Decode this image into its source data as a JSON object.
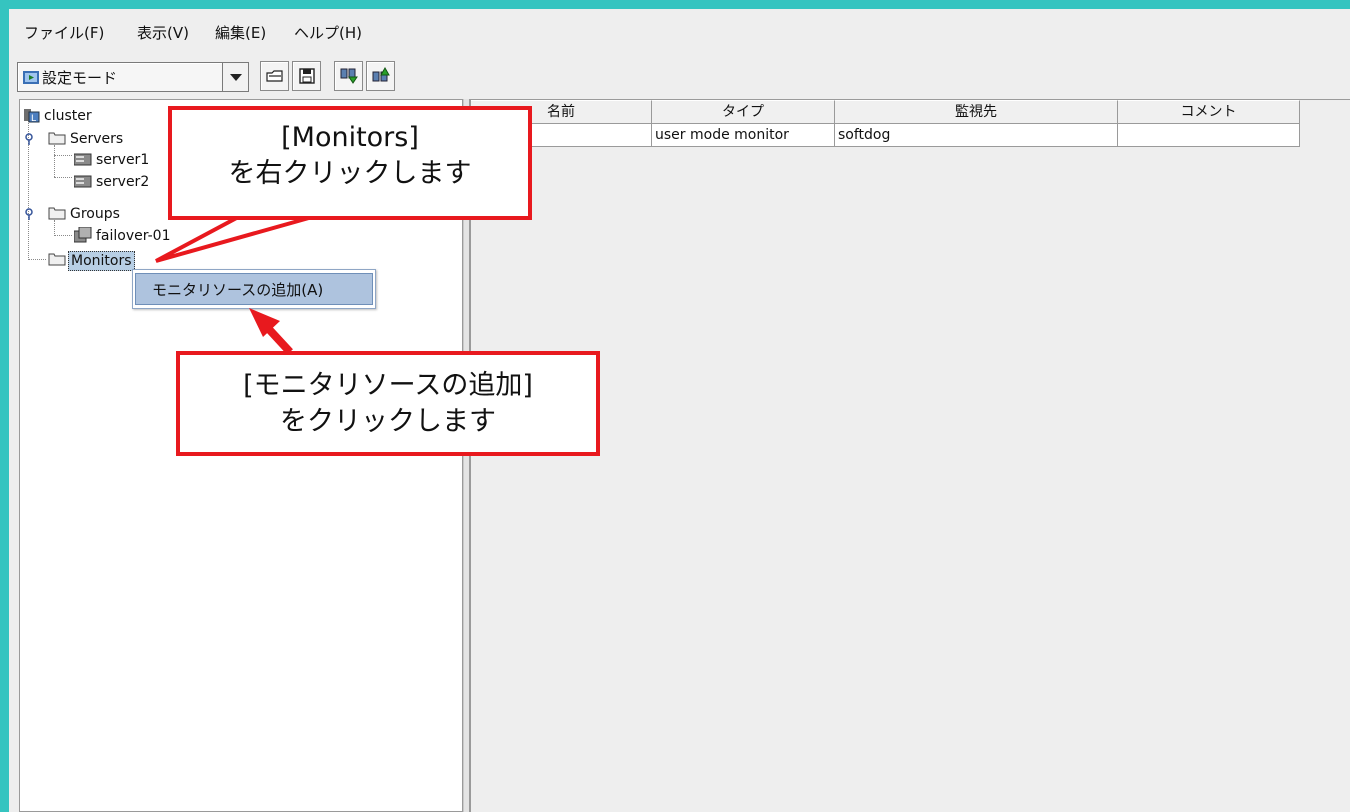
{
  "menubar": {
    "items": [
      {
        "label": "ファイル(F)"
      },
      {
        "label": "表示(V)"
      },
      {
        "label": "編集(E)"
      },
      {
        "label": "ヘルプ(H)"
      }
    ]
  },
  "toolbar": {
    "mode_select": {
      "value": "設定モード",
      "icon": "config-mode-icon"
    },
    "buttons": [
      {
        "icon": "open-folder-icon"
      },
      {
        "icon": "save-icon"
      },
      {
        "icon": "download-config-icon"
      },
      {
        "icon": "upload-config-icon"
      }
    ]
  },
  "tree": {
    "root": {
      "label": "cluster",
      "icon": "cluster-icon"
    },
    "servers": {
      "label": "Servers",
      "children": [
        "server1",
        "server2"
      ]
    },
    "groups": {
      "label": "Groups",
      "children": [
        "failover-01"
      ]
    },
    "monitors": {
      "label": "Monitors"
    }
  },
  "context_menu": {
    "items": [
      {
        "label": "モニタリソースの追加(A)"
      }
    ]
  },
  "table": {
    "headers": [
      "名前",
      "タイプ",
      "監視先",
      "コメント"
    ],
    "rows": [
      [
        "",
        "user mode monitor",
        "softdog",
        ""
      ]
    ]
  },
  "callouts": {
    "monitors": {
      "line1": "[Monitors]",
      "line2": "を右クリックします"
    },
    "add_resource": {
      "line1": "[モニタリソースの追加]",
      "line2": "をクリックします"
    }
  },
  "colors": {
    "frame": "#35c4c0",
    "callout_border": "#e8191e",
    "selection": "#aec3de"
  }
}
